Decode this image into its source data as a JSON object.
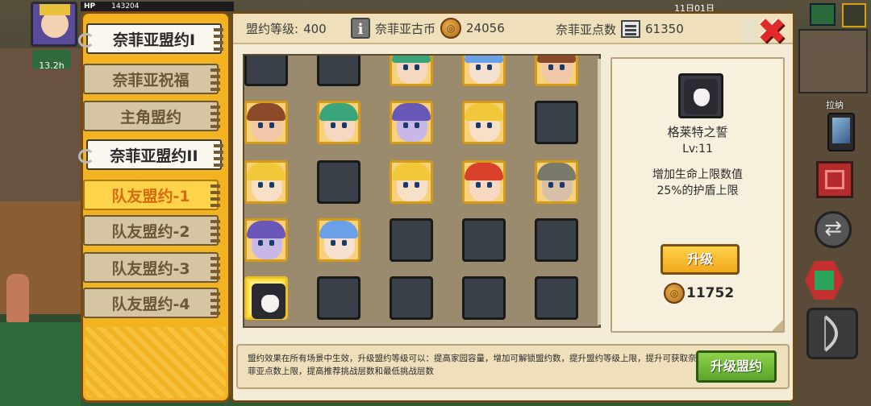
{
  "hud": {
    "hp_label": "HP",
    "hp_value": "143204",
    "timer": "13.2h",
    "pull_label": "拉纳",
    "top_time": "11日01日"
  },
  "tabs": [
    {
      "label": "奈菲亚盟约I",
      "state": "white"
    },
    {
      "label": "奈菲亚祝福",
      "state": "normal"
    },
    {
      "label": "主角盟约",
      "state": "normal"
    },
    {
      "label": "奈菲亚盟约II",
      "state": "white"
    },
    {
      "label": "队友盟约-1",
      "state": "active"
    },
    {
      "label": "队友盟约-2",
      "state": "normal"
    },
    {
      "label": "队友盟约-3",
      "state": "normal"
    },
    {
      "label": "队友盟约-4",
      "state": "normal"
    }
  ],
  "topbar": {
    "level_label": "盟约等级:",
    "level_value": "400",
    "info_icon": "i",
    "coin_label": "奈菲亚古币",
    "coin_value": "24056",
    "points_label": "奈菲亚点数",
    "points_value": "61350",
    "close_symbol": "✖"
  },
  "grid": {
    "rows": [
      [
        "empty",
        "empty",
        "green",
        "blue",
        "brown"
      ],
      [
        "brown",
        "green",
        "purple",
        "blonde",
        "empty"
      ],
      [
        "blonde",
        "empty",
        "blonde",
        "red",
        "gray"
      ],
      [
        "purple",
        "blue",
        "empty",
        "empty",
        "empty"
      ],
      [
        "veil",
        "empty",
        "empty",
        "empty",
        "empty"
      ]
    ]
  },
  "detail": {
    "name": "格莱特之誓",
    "level": "Lv:11",
    "effect": "增加生命上限数值\n25%的护盾上限",
    "upgrade_label": "升级",
    "cost": "11752"
  },
  "bottom": {
    "text": "盟约效果在所有场景中生效，升级盟约等级可以：提高家园容量，增加可解锁盟约数，提升盟约等级上限，提升可获取奈菲亚点数上限，提高推荐挑战层数和最低挑战层数",
    "button_label": "升级盟约"
  },
  "colors": {
    "panel": "#f4ecd6",
    "tab_column": "#f3b21f",
    "active_tab_text": "#d86a10",
    "upgrade_button": "#f0a81c",
    "alliance_button": "#5aa52a",
    "close": "#e02a2a"
  }
}
